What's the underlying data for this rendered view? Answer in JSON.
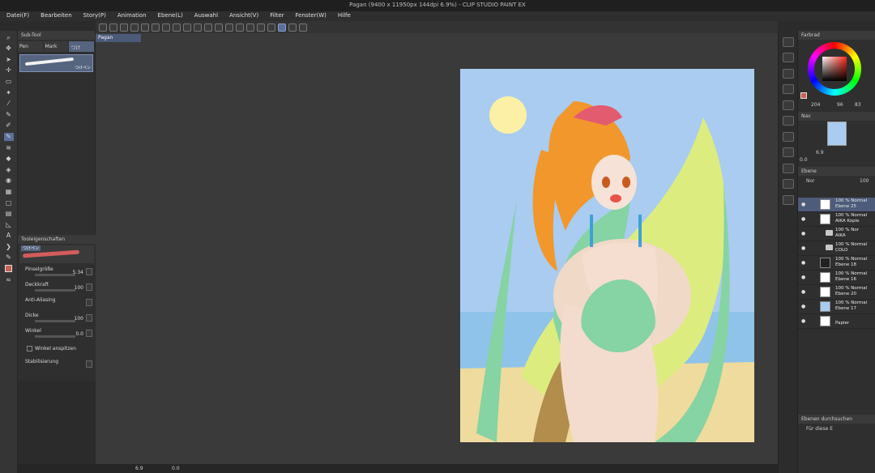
{
  "window": {
    "title": "Pagan (9400 x 11950px 144dpi 6.9%) - CLIP STUDIO PAINT EX"
  },
  "menu": [
    "Datei(F)",
    "Bearbeiten",
    "Story(P)",
    "Animation",
    "Ebene(L)",
    "Auswahl",
    "Ansicht(V)",
    "Filter",
    "Fenster(W)",
    "Hilfe"
  ],
  "doc_tab": {
    "label": "Pagan"
  },
  "subtool": {
    "header": "Sub-Tool",
    "tabs": [
      "Pen",
      "Mark",
      "つけ"
    ],
    "brush_name": "つけペン"
  },
  "tool_properties": {
    "header": "Tooleigenschaften",
    "preview_name": "つけペン",
    "brush_size": {
      "label": "Pinselgröße",
      "value": "5.34"
    },
    "opacity": {
      "label": "Deckkraft",
      "value": "100"
    },
    "anti_aliasing": {
      "label": "Anti-Aliasing"
    },
    "thickness": {
      "label": "Dicke",
      "value": "100"
    },
    "angle": {
      "label": "Winkel",
      "value": "0.0"
    },
    "taper_angle": {
      "label": "Winkel anspitzen"
    },
    "stabilization": {
      "label": "Stabilisierung"
    }
  },
  "status": {
    "zoom": "6.9",
    "rotation": "0.0"
  },
  "color_panel": {
    "header": "Farbrad",
    "r": "204",
    "g": "96",
    "b": "83"
  },
  "navigator": {
    "header": "Nav",
    "zoom": "6.9",
    "rotation": "0.0"
  },
  "layers": {
    "header": "Ebene",
    "blend_mode": "Nor",
    "opacity": "100",
    "items": [
      {
        "l1": "100 % Normal",
        "l2": "Ebene 25",
        "selected": true,
        "folder": false
      },
      {
        "l1": "100 % Normal",
        "l2": "AIKA Kopie",
        "selected": false,
        "folder": false
      },
      {
        "l1": "100 % Nor",
        "l2": "AIKA",
        "selected": false,
        "folder": true
      },
      {
        "l1": "100 % Normal",
        "l2": "COLO",
        "selected": false,
        "folder": true
      },
      {
        "l1": "100 % Normal",
        "l2": "Ebene 18",
        "selected": false,
        "folder": false
      },
      {
        "l1": "100 % Normal",
        "l2": "Ebene 16",
        "selected": false,
        "folder": false
      },
      {
        "l1": "100 % Normal",
        "l2": "Ebene 20",
        "selected": false,
        "folder": false
      },
      {
        "l1": "100 % Normal",
        "l2": "Ebene 17",
        "selected": false,
        "folder": false
      },
      {
        "l1": "",
        "l2": "Papier",
        "selected": false,
        "folder": false
      }
    ]
  },
  "search_layers": {
    "header": "Ebenen durchsuchen",
    "filter": "Für diese E"
  },
  "colors": {
    "accent": "#5a6f9a",
    "main_color": "#cc6053"
  }
}
